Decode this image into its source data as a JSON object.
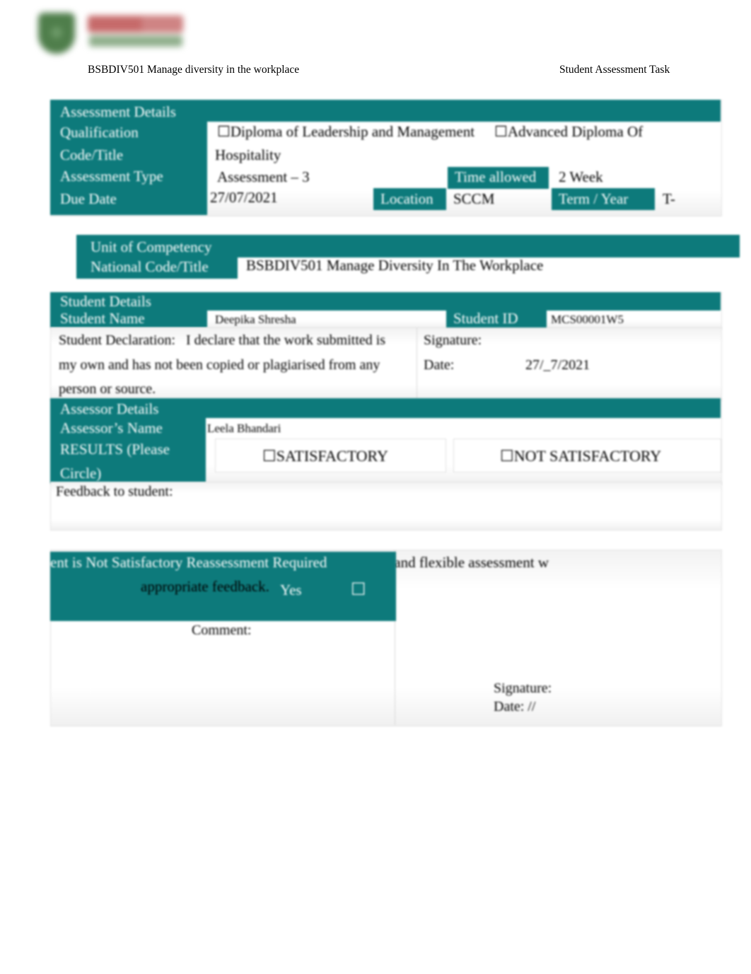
{
  "logo": {
    "alt": "college-logo",
    "shield_color": "#4f7e4b",
    "wordmark_color": "#c66a6a"
  },
  "running_header": {
    "left": "BSBDIV501 Manage diversity in the workplace",
    "right": "Student Assessment Task"
  },
  "theme": {
    "accent": "#0d7a7b",
    "panel_bg": "#ffffff",
    "text": "#000000",
    "label_text": "#ffffff"
  },
  "assessment_details": {
    "section_title": "Assessment Details",
    "labels": {
      "qualification": "Qualification",
      "code_title": "Code/Title",
      "assessment_type": "Assessment Type",
      "due_date": "Due Date",
      "time_allowed": "Time allowed",
      "location": "Location",
      "term_year": "Term / Year"
    },
    "qualification_options": [
      {
        "checkbox": "☐",
        "label": "Diploma of Leadership and Management"
      },
      {
        "checkbox": "☐",
        "label": "Advanced Diploma Of"
      }
    ],
    "code_title_value": "Hospitality",
    "assessment_type_value": "Assessment – 3",
    "due_date_value": "27/07/2021",
    "time_allowed_value": "2 Week",
    "location_value": "SCCM",
    "term_year_value": "T-"
  },
  "unit_of_competency": {
    "section_title": "Unit of Competency",
    "label": "National Code/Title",
    "value": "BSBDIV501 Manage Diversity In The Workplace"
  },
  "student_details": {
    "section_title": "Student Details",
    "name_label": "Student Name",
    "name_value": "Deepika Shresha",
    "id_label": "Student ID",
    "id_value": "MCS00001W5"
  },
  "student_declaration": {
    "label": "Student Declaration:",
    "line1": "I declare that the work submitted is",
    "line2": "my own and has not been copied or plagiarised from any",
    "line3": "person or source.",
    "signature_label": "Signature:",
    "date_label": "Date:",
    "date_value": "27/_7/2021"
  },
  "assessor_details": {
    "section_title": "Assessor Details",
    "name_label": "Assessor’s Name",
    "name_value": "Leela Bhandari",
    "results_label_line1": "RESULTS (Please",
    "results_label_line2": "Circle)",
    "results": [
      {
        "checkbox": "☐",
        "label": "SATISFACTORY"
      },
      {
        "checkbox": "☐",
        "label": "NOT SATISFACTORY"
      }
    ]
  },
  "feedback": {
    "label": "Feedback to student:",
    "value": ""
  },
  "assessor_declaration": {
    "overlay_text": "ent is Not Satisfactory Reassessment Required",
    "declaration_text": "re that I have conducted a fair, valid, reliable, and flexible assessment w",
    "appropriate_feedback": "appropriate feedback.",
    "yes_label": "Yes",
    "yes_checkbox": "☐",
    "comment_label": "Comment:",
    "comment_value": "",
    "signature_label": "Signature:",
    "date_label": "Date: //"
  }
}
